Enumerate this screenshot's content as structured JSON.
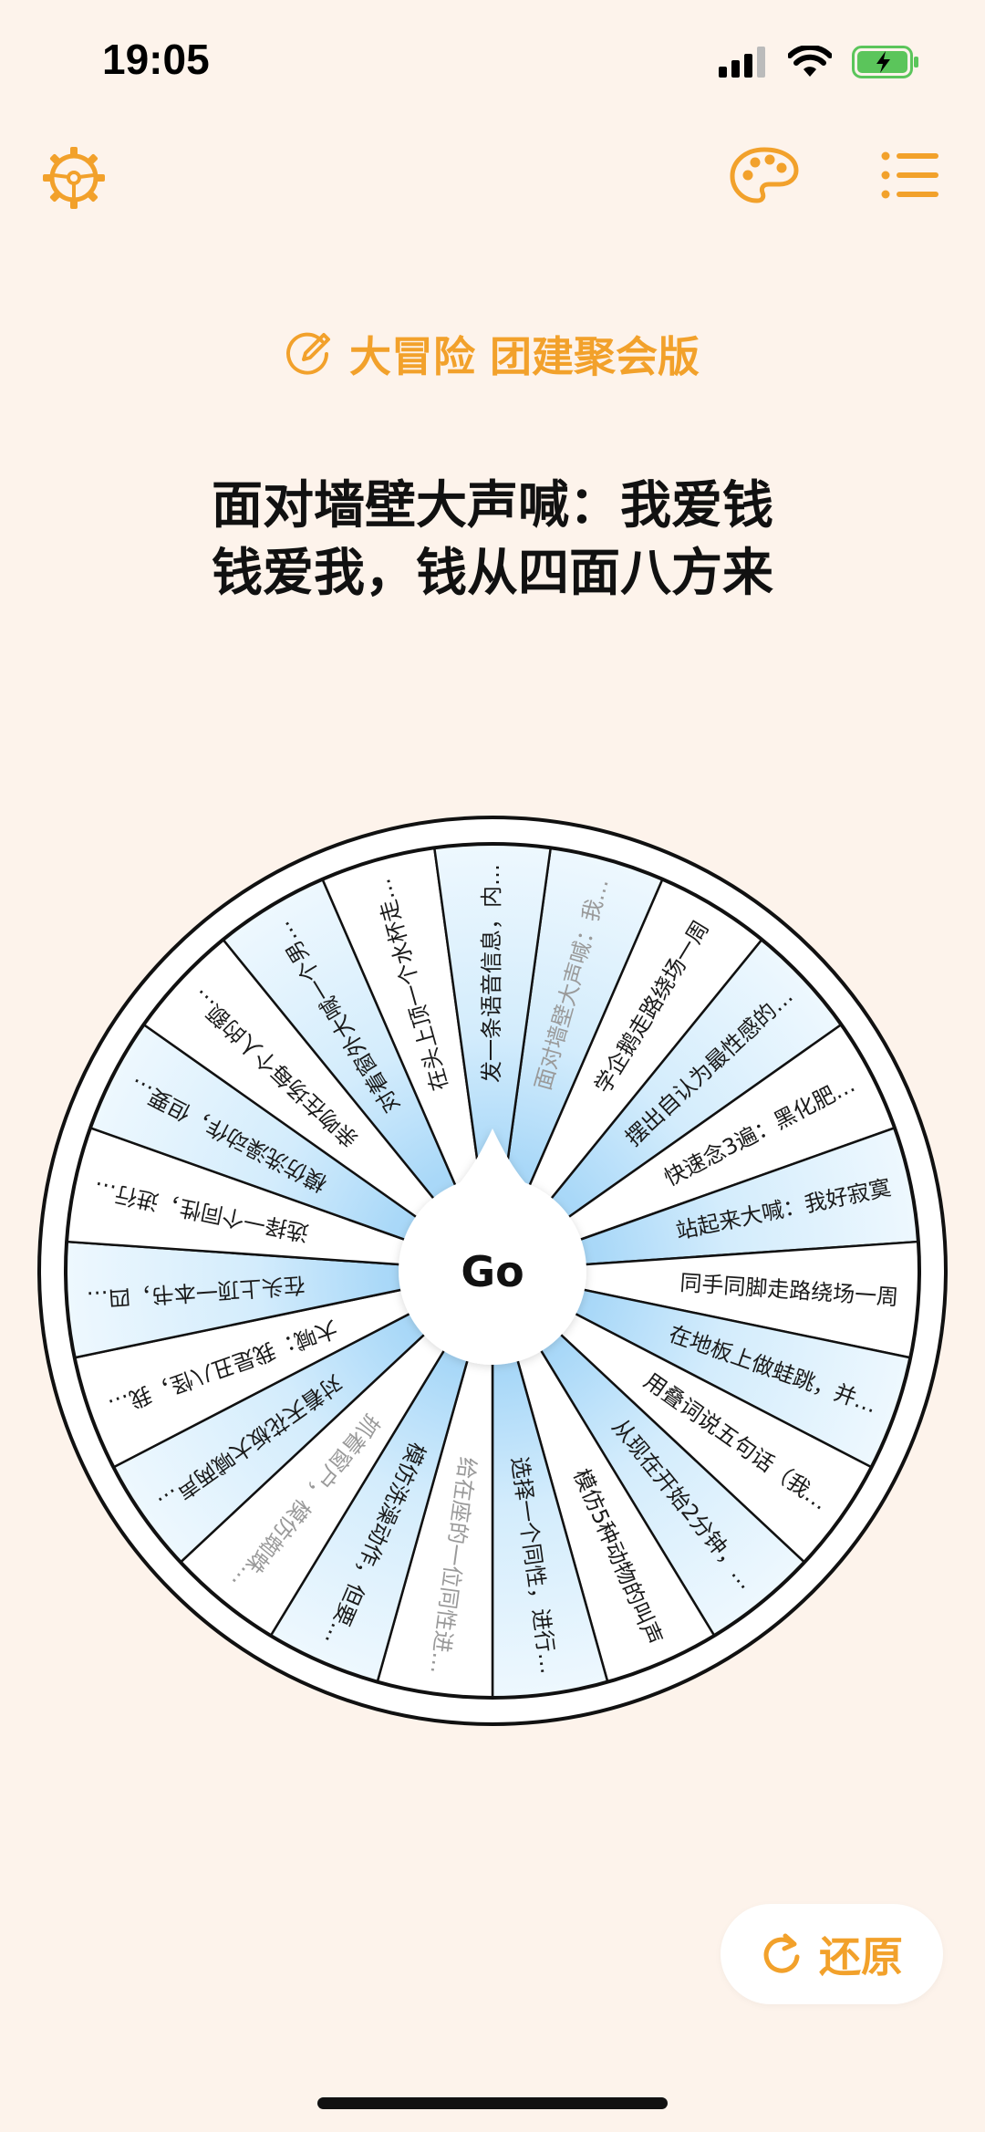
{
  "status": {
    "time": "19:05"
  },
  "colors": {
    "accent": "#F2A12B",
    "background": "#FDF3EB",
    "segment_blue": "#C8E6FB"
  },
  "header": {
    "settings_icon": "steering-wheel-gear-icon",
    "palette_icon": "palette-icon",
    "list_icon": "list-icon"
  },
  "title": {
    "icon": "edit-pen-icon",
    "text": "大冒险 团建聚会版"
  },
  "prompt": {
    "line1": "面对墙壁大声喊：我爱钱",
    "line2": "钱爱我，钱从四面八方来"
  },
  "wheel": {
    "center_label": "Go",
    "segments": [
      {
        "text": "面对墙壁大声喊：我…",
        "muted": true
      },
      {
        "text": "学企鹅走路绕场一周"
      },
      {
        "text": "摆出自认为最性感的…"
      },
      {
        "text": "快速念3遍：黑化肥…"
      },
      {
        "text": "站起来大喊：我好寂寞"
      },
      {
        "text": "同手同脚走路绕场一周"
      },
      {
        "text": "在地板上做蛙跳，并…"
      },
      {
        "text": "用叠词说五句话（我…"
      },
      {
        "text": "从现在开始2分钟，…"
      },
      {
        "text": "模仿5种动物的叫声"
      },
      {
        "text": "选择一个同性，进行…"
      },
      {
        "text": "给在座的一位同性进…",
        "muted": true
      },
      {
        "text": "模仿洗澡动作，但要…"
      },
      {
        "text": "抓着窗户，模仿蜘蛛…",
        "muted": true
      },
      {
        "text": "对着天花板大喊两声…"
      },
      {
        "text": "大喊：我是丑八怪，我…"
      },
      {
        "text": "在头上顶一本书，四…"
      },
      {
        "text": "选择一个同性，进行…"
      },
      {
        "text": "模仿洗澡动作，但要…"
      },
      {
        "text": "亲吻在场每个人的额…"
      },
      {
        "text": "对着窗外大喊一个男…"
      },
      {
        "text": "在头上顶一个水杯走…"
      },
      {
        "text": "发一条语音信息，内…"
      }
    ]
  },
  "reset_button": {
    "label": "还原",
    "icon": "restore-icon"
  }
}
